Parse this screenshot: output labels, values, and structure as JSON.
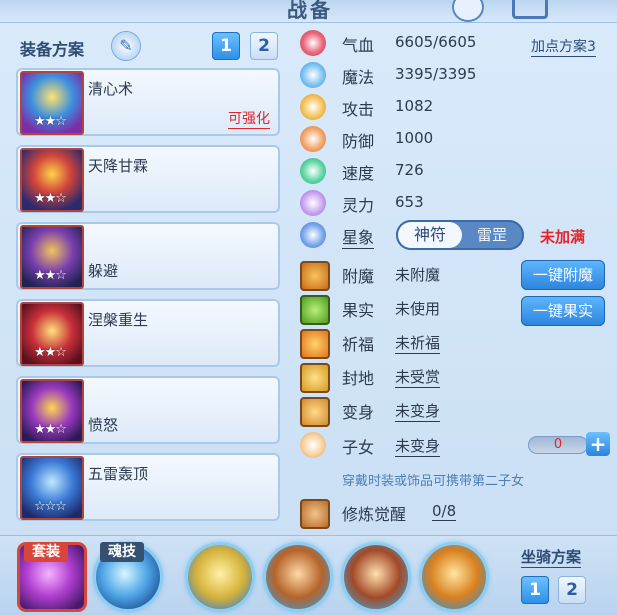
{
  "window": {
    "title": "战备"
  },
  "left": {
    "header": "装备方案",
    "plans": [
      "1",
      "2"
    ],
    "slots": [
      {
        "name": "清心术",
        "stars": "★★☆",
        "badge": "可强化"
      },
      {
        "name": "天降甘霖",
        "stars": "★★☆",
        "badge": ""
      },
      {
        "name": "躲避",
        "stars": "★★☆",
        "badge": ""
      },
      {
        "name": "涅槃重生",
        "stars": "★★☆",
        "badge": ""
      },
      {
        "name": "愤怒",
        "stars": "★★☆",
        "badge": ""
      },
      {
        "name": "五雷轰顶",
        "stars": "☆☆☆",
        "badge": ""
      }
    ]
  },
  "stats": {
    "plan_link": "加点方案3",
    "rows": [
      {
        "label": "气血",
        "value": "6605/6605",
        "icon": "heart-icon"
      },
      {
        "label": "魔法",
        "value": "3395/3395",
        "icon": "mana-icon"
      },
      {
        "label": "攻击",
        "value": "1082",
        "icon": "sword-icon"
      },
      {
        "label": "防御",
        "value": "1000",
        "icon": "shield-icon"
      },
      {
        "label": "速度",
        "value": "726",
        "icon": "lightning-icon"
      },
      {
        "label": "灵力",
        "value": "653",
        "icon": "spirit-icon"
      }
    ],
    "star": {
      "label": "星象",
      "on": "神符",
      "off": "雷罡",
      "status": "未加满"
    }
  },
  "extras": [
    {
      "label": "附魔",
      "value": "未附魔",
      "button": "一键附魔"
    },
    {
      "label": "果实",
      "value": "未使用",
      "button": "一键果实"
    },
    {
      "label": "祈福",
      "value": "未祈福",
      "button": ""
    },
    {
      "label": "封地",
      "value": "未受赏",
      "button": ""
    },
    {
      "label": "变身",
      "value": "未变身",
      "button": ""
    }
  ],
  "child": {
    "label": "子女",
    "value": "未变身",
    "count": "0",
    "hint": "穿戴时装或饰品可携带第二子女"
  },
  "cultivate": {
    "label": "修炼觉醒",
    "value": "0/8"
  },
  "bottom": {
    "suit": "套装",
    "soul": "魂技",
    "mount_label": "坐骑方案",
    "mount_plans": [
      "1",
      "2"
    ]
  },
  "colors": {
    "accent": "#2a84dc",
    "warn": "#e3242b"
  }
}
